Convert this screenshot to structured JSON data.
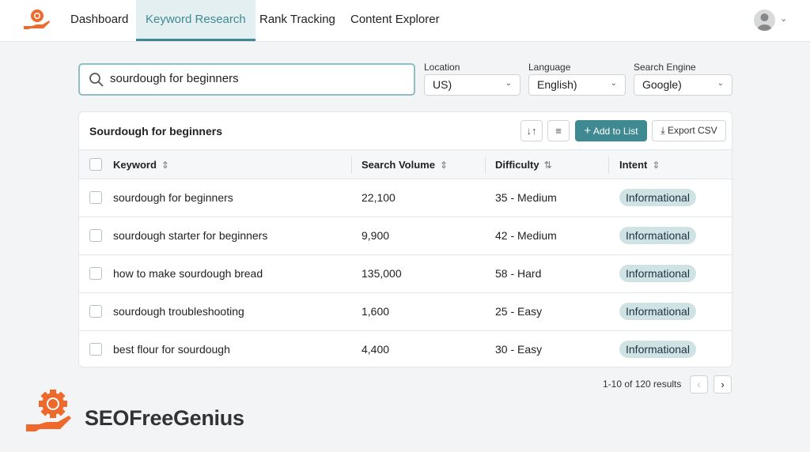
{
  "nav": {
    "tabs": [
      {
        "label": "Dashboard"
      },
      {
        "label": "Keyword Research",
        "active": true
      },
      {
        "label": "Rank Tracking"
      },
      {
        "label": "Content Explorer"
      }
    ]
  },
  "search": {
    "value": "sourdough for beginners"
  },
  "filters": [
    {
      "label": "Location",
      "value": "US)"
    },
    {
      "label": "Language",
      "value": "English)"
    },
    {
      "label": "Search Engine",
      "value": "Google)"
    }
  ],
  "card": {
    "title": "Sourdough for beginners",
    "add_label": "Add to List",
    "export_label": "Export CSV"
  },
  "table": {
    "headers": [
      "Keyword",
      "Search Volume",
      "Difficulty",
      "Intent"
    ],
    "rows": [
      {
        "keyword": "sourdough for beginners",
        "volume": "22,100",
        "difficulty": "35 - Medium",
        "intent": "Informational"
      },
      {
        "keyword": "sourdough starter for beginners",
        "volume": "9,900",
        "difficulty": "42 - Medium",
        "intent": "Informational"
      },
      {
        "keyword": "how to make sourdough bread",
        "volume": "135,000",
        "difficulty": "58 - Hard",
        "intent": "Informational"
      },
      {
        "keyword": "sourdough troubleshooting",
        "volume": "1,600",
        "difficulty": "25 - Easy",
        "intent": "Informational"
      },
      {
        "keyword": "best flour for sourdough",
        "volume": "4,400",
        "difficulty": "30 - Easy",
        "intent": "Informational"
      }
    ]
  },
  "pagination": {
    "info": "1-10 of 120 results"
  },
  "brand": {
    "name": "SEOFreeGenius"
  },
  "colors": {
    "accent": "#3f8a92",
    "brand": "#ee6a2c"
  }
}
